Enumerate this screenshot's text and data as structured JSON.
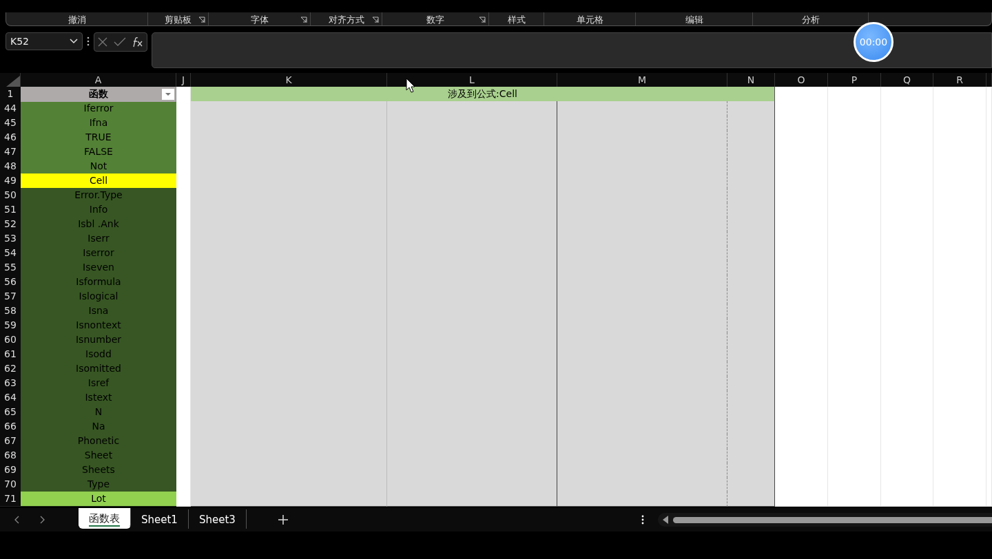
{
  "ribbon_groups": [
    {
      "label": "撤消",
      "launcher": false
    },
    {
      "label": "剪贴板",
      "launcher": true
    },
    {
      "label": "字体",
      "launcher": true
    },
    {
      "label": "对齐方式",
      "launcher": true
    },
    {
      "label": "数字",
      "launcher": true
    },
    {
      "label": "样式",
      "launcher": false
    },
    {
      "label": "单元格",
      "launcher": false
    },
    {
      "label": "编辑",
      "launcher": false
    },
    {
      "label": "分析",
      "launcher": false
    }
  ],
  "formula_bar": {
    "name_box": "K52"
  },
  "timer": "00:00",
  "column_headers": [
    "A",
    "J",
    "K",
    "L",
    "M",
    "N",
    "O",
    "P",
    "Q",
    "R"
  ],
  "header_row": {
    "number": "1",
    "title": "函数",
    "merged_title": "涉及到公式:Cell"
  },
  "rows": [
    {
      "number": "44",
      "name": "Iferror",
      "color": "#538135"
    },
    {
      "number": "45",
      "name": "Ifna",
      "color": "#538135"
    },
    {
      "number": "46",
      "name": "TRUE",
      "color": "#538135"
    },
    {
      "number": "47",
      "name": "FALSE",
      "color": "#538135"
    },
    {
      "number": "48",
      "name": "Not",
      "color": "#538135"
    },
    {
      "number": "49",
      "name": "Cell",
      "color": "#ffff00"
    },
    {
      "number": "50",
      "name": "Error.Type",
      "color": "#375623"
    },
    {
      "number": "51",
      "name": "Info",
      "color": "#375623"
    },
    {
      "number": "52",
      "name": "Isbl .Ank",
      "color": "#375623"
    },
    {
      "number": "53",
      "name": "Iserr",
      "color": "#375623"
    },
    {
      "number": "54",
      "name": "Iserror",
      "color": "#375623"
    },
    {
      "number": "55",
      "name": "Iseven",
      "color": "#375623"
    },
    {
      "number": "56",
      "name": "Isformula",
      "color": "#375623"
    },
    {
      "number": "57",
      "name": "Islogical",
      "color": "#375623"
    },
    {
      "number": "58",
      "name": "Isna",
      "color": "#375623"
    },
    {
      "number": "59",
      "name": "Isnontext",
      "color": "#375623"
    },
    {
      "number": "60",
      "name": "Isnumber",
      "color": "#375623"
    },
    {
      "number": "61",
      "name": "Isodd",
      "color": "#375623"
    },
    {
      "number": "62",
      "name": "Isomitted",
      "color": "#375623"
    },
    {
      "number": "63",
      "name": "Isref",
      "color": "#375623"
    },
    {
      "number": "64",
      "name": "Istext",
      "color": "#375623"
    },
    {
      "number": "65",
      "name": "N",
      "color": "#375623"
    },
    {
      "number": "66",
      "name": "Na",
      "color": "#375623"
    },
    {
      "number": "67",
      "name": "Phonetic",
      "color": "#375623"
    },
    {
      "number": "68",
      "name": "Sheet",
      "color": "#375623"
    },
    {
      "number": "69",
      "name": "Sheets",
      "color": "#375623"
    },
    {
      "number": "70",
      "name": "Type",
      "color": "#375623"
    },
    {
      "number": "71",
      "name": "Lot",
      "color": "#92d050"
    }
  ],
  "sheet_tabs": [
    {
      "label": "函数表",
      "selected": true
    },
    {
      "label": "Sheet1",
      "selected": false
    },
    {
      "label": "Sheet3",
      "selected": false
    }
  ]
}
